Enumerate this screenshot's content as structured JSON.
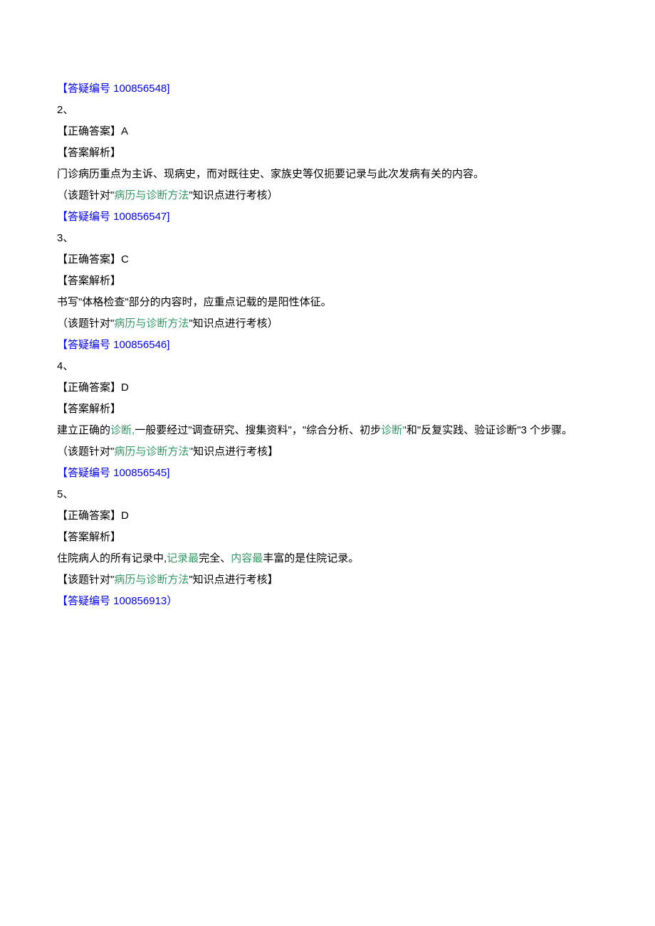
{
  "items": [
    {
      "ref_prefix": "【答疑编号 ",
      "ref_num": "100856548]",
      "number": "2、",
      "answer_label": "【正确答案】",
      "answer_value": "A",
      "analysis_label": "【答案解析】",
      "analysis_text": "门诊病历重点为主诉、现病史，而对既往史、家族史等仅扼要记录与此次发病有关的内容。",
      "topic_prefix": "（该题针对\"",
      "topic_name": "病历与诊断方法",
      "topic_suffix": "\"知识点进行考核）",
      "ref2_prefix": "【答疑编号 ",
      "ref2_num": "100856547]"
    },
    {
      "number": "3、",
      "answer_label": "【正确答案】",
      "answer_value": "C",
      "analysis_label": "【答案解析】",
      "analysis_text": "书写\"体格检查\"部分的内容时，应重点记载的是阳性体征。",
      "topic_prefix": "（该题针对\"",
      "topic_name": "病历与诊断方法",
      "topic_suffix": "\"知识点进行考核）",
      "ref2_prefix": "【答疑编号 ",
      "ref2_num": "100856546]"
    },
    {
      "number": "4、",
      "answer_label": "【正确答案】",
      "answer_value": "D",
      "analysis_label": "【答案解析】",
      "analysis_pre": "建立正确的",
      "analysis_green1": "诊断,",
      "analysis_mid": "一般要经过\"调查研究、搜集资料\"，\"综合分析、初步",
      "analysis_green2": "诊断'",
      "analysis_post": "'和\"反复实践、验证诊断\"3 个步骤。",
      "topic_prefix": "（该题针对\"",
      "topic_name": "病历与诊断方法'",
      "topic_suffix": "'知识点进行考核】",
      "ref2_prefix": "【答疑编号 ",
      "ref2_num": "100856545]"
    },
    {
      "number": "5、",
      "answer_label": "【正确答案】",
      "answer_value": "D",
      "analysis_label": "【答案解析】",
      "analysis_pre": "住院病人的所有记录中,",
      "analysis_green1": "记录最",
      "analysis_mid": "完全、",
      "analysis_green2": "内容最",
      "analysis_post": "丰富的是住院记录。",
      "topic_prefix": "【该题针对\"",
      "topic_name": "病历与诊断方法",
      "topic_suffix": "\"知识点进行考核】",
      "ref2_prefix": "【答疑编号 ",
      "ref2_num": "100856913）"
    }
  ]
}
